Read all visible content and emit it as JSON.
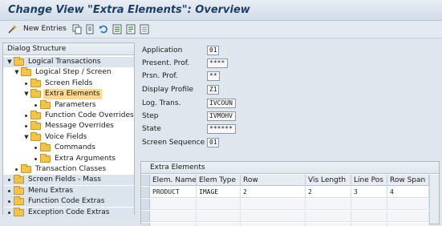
{
  "window": {
    "title": "Change View \"Extra Elements\": Overview"
  },
  "toolbar": {
    "new_entries_label": "New Entries",
    "icons": [
      "new-entries-icon",
      "copy-icon",
      "delete-icon",
      "undo-icon",
      "select-all-icon",
      "select-block-icon",
      "deselect-icon"
    ]
  },
  "dialog_structure": {
    "title": "Dialog Structure",
    "nodes": [
      {
        "label": "Logical Transactions",
        "expanded": true,
        "depth": 0
      },
      {
        "label": "Logical Step / Screen",
        "expanded": true,
        "depth": 1
      },
      {
        "label": "Screen Fields",
        "expanded": false,
        "depth": 2
      },
      {
        "label": "Extra Elements",
        "expanded": true,
        "depth": 2,
        "selected": true
      },
      {
        "label": "Parameters",
        "expanded": false,
        "depth": 3
      },
      {
        "label": "Function Code Overrides",
        "expanded": false,
        "depth": 2
      },
      {
        "label": "Message Overrides",
        "expanded": false,
        "depth": 2
      },
      {
        "label": "Voice Fields",
        "expanded": true,
        "depth": 2
      },
      {
        "label": "Commands",
        "expanded": false,
        "depth": 3
      },
      {
        "label": "Extra Arguments",
        "expanded": false,
        "depth": 3
      },
      {
        "label": "Transaction Classes",
        "expanded": false,
        "depth": 1
      },
      {
        "label": "Screen Fields - Mass",
        "expanded": false,
        "depth": 0
      },
      {
        "label": "Menu Extras",
        "expanded": false,
        "depth": 0
      },
      {
        "label": "Function Code Extras",
        "expanded": false,
        "depth": 0
      },
      {
        "label": "Exception Code Extras",
        "expanded": false,
        "depth": 0
      }
    ]
  },
  "header_fields": [
    {
      "label": "Application",
      "value": "01"
    },
    {
      "label": "Present. Prof.",
      "value": "****"
    },
    {
      "label": "Prsn. Prof.",
      "value": "**"
    },
    {
      "label": "Display Profile",
      "value": "Z1"
    },
    {
      "label": "Log. Trans.",
      "value": "IVCOUN"
    },
    {
      "label": "Step",
      "value": "IVMOHV"
    },
    {
      "label": "State",
      "value": "******"
    },
    {
      "label": "Screen Sequence",
      "value": "01"
    }
  ],
  "extra_elements": {
    "title": "Extra Elements",
    "columns": [
      "Elem. Name",
      "Elem Type",
      "Row",
      "Vis Length",
      "Line Pos",
      "Row Span"
    ],
    "rows": [
      [
        "PRODUCT",
        "IMAGE",
        "2",
        "2",
        "3",
        "4"
      ]
    ]
  },
  "colors": {
    "title": "#1c3f66",
    "selection": "#fdd98f",
    "folder": "#f2c54a"
  }
}
